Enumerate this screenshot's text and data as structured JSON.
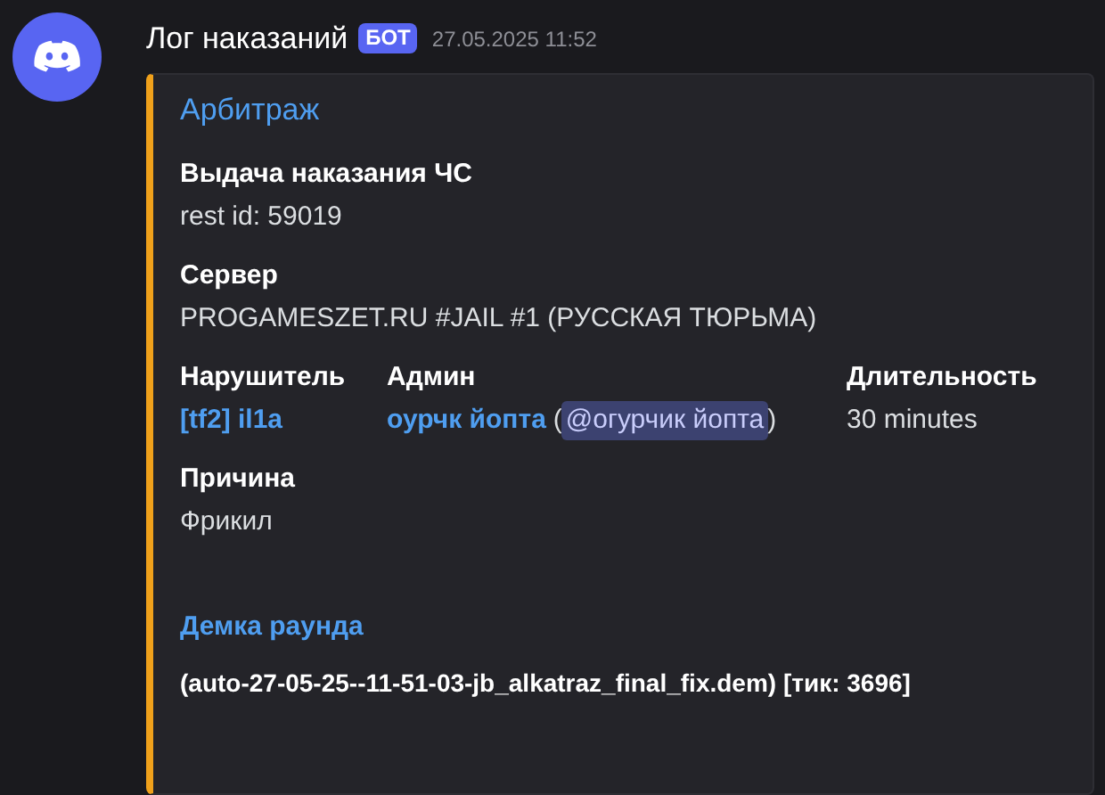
{
  "message": {
    "author": "Лог наказаний",
    "badge": "БОТ",
    "timestamp": "27.05.2025 11:52"
  },
  "embed": {
    "color": "#f0a11b",
    "title": "Арбитраж",
    "fields": [
      {
        "name": "Выдача наказания ЧС",
        "kind": "block",
        "value": [
          {
            "kind": "text",
            "text": "rest id: 59019"
          }
        ]
      },
      {
        "name": "Сервер",
        "kind": "block",
        "value": [
          {
            "kind": "text",
            "text": "PROGAMESZET.RU #JAIL #1 (РУССКАЯ ТЮРЬМА)"
          }
        ]
      },
      {
        "name": "Нарушитель",
        "kind": "inline",
        "value": [
          {
            "kind": "link",
            "text": "[tf2] il1a"
          }
        ]
      },
      {
        "name": "Админ",
        "kind": "inline",
        "value": [
          {
            "kind": "link",
            "text": "оурчк йопта"
          },
          {
            "kind": "text",
            "text": "("
          },
          {
            "kind": "mention",
            "text": "@огурчик йопта"
          },
          {
            "kind": "text",
            "text": ")"
          }
        ]
      },
      {
        "name": "Длительность",
        "kind": "inline",
        "value": [
          {
            "kind": "text",
            "text": "30 minutes"
          }
        ]
      },
      {
        "name": "Причина",
        "kind": "block",
        "value": [
          {
            "kind": "text",
            "text": "Фрикил"
          }
        ]
      },
      {
        "name": "Демка раунда",
        "kind": "link_block",
        "value": [
          {
            "kind": "bold",
            "text": "(auto-27-05-25--11-51-03-jb_alkatraz_final_fix.dem) [тик: 3696]"
          }
        ]
      }
    ]
  }
}
